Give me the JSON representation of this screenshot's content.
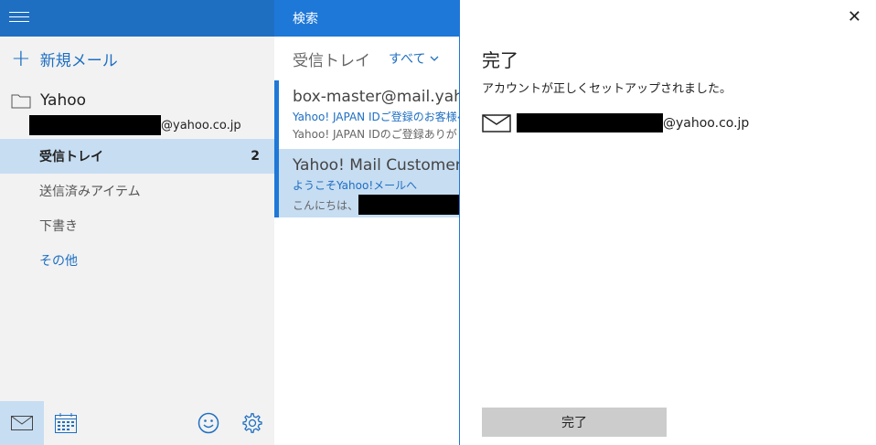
{
  "sidebar": {
    "new_mail_label": "新規メール",
    "account_name": "Yahoo",
    "account_email_domain": "@yahoo.co.jp",
    "folders": [
      {
        "label": "受信トレイ",
        "count": "2",
        "selected": true
      },
      {
        "label": "送信済みアイテム",
        "count": ""
      },
      {
        "label": "下書き",
        "count": ""
      },
      {
        "label": "その他",
        "count": ""
      }
    ]
  },
  "list": {
    "search_placeholder": "検索",
    "folder_title": "受信トレイ",
    "filter_label": "すべて",
    "items": [
      {
        "from": "box-master@mail.yahoo",
        "subject": "Yahoo! JAPAN IDご登録のお客様へ",
        "preview": "Yahoo! JAPAN IDのご登録ありがとう"
      },
      {
        "from": "Yahoo! Mail Customer S",
        "subject": "ようこそYahoo!メールへ",
        "preview": "こんにちは、"
      }
    ]
  },
  "panel": {
    "title": "完了",
    "message": "アカウントが正しくセットアップされました。",
    "email_domain": "@yahoo.co.jp",
    "done_label": "完了",
    "close_glyph": "✕"
  },
  "colors": {
    "accent": "#1e6fc2",
    "header": "#1e78d8",
    "selected": "#c7ddf2"
  }
}
